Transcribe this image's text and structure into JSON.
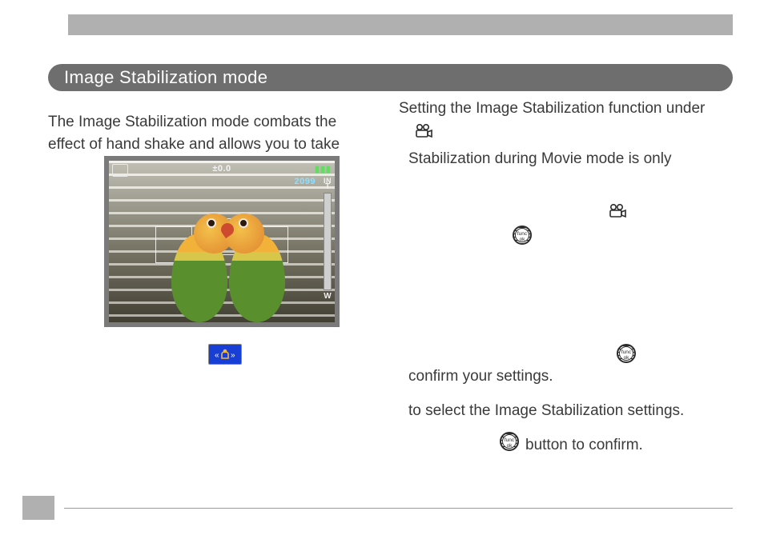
{
  "heading": "Image Stabilization mode",
  "left": {
    "p1": "The Image Stabilization mode combats the effect of hand shake and allows you to take"
  },
  "right": {
    "p1": "Setting the Image Stabilization function under",
    "p2": "Stabilization during Movie mode is only",
    "confirm": "confirm your settings.",
    "select": "to select the Image Stabilization settings.",
    "press_confirm": "button to confirm."
  },
  "osd": {
    "ev": "±0.0",
    "count": "2099",
    "mem": "IN",
    "zoom_tele": "T",
    "zoom_wide": "W"
  },
  "icons": {
    "func_label": "func\nok"
  }
}
